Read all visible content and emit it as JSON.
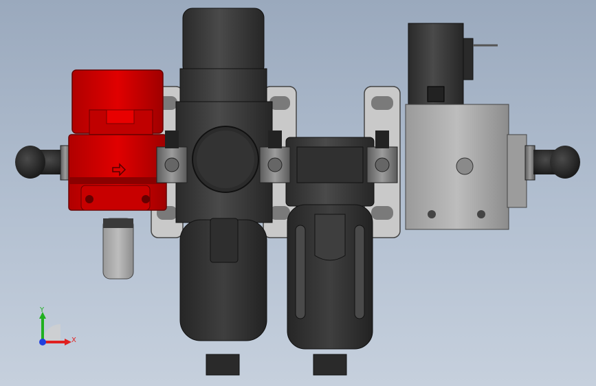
{
  "viewport": {
    "background_top": "#9aa9bd",
    "background_bottom": "#c6d0dd"
  },
  "model": {
    "accent_red": "#d90000",
    "body_dark": "#3a3a3a",
    "metal_gray": "#8a8a8a",
    "block_gray": "#a6a6a6"
  },
  "triad": {
    "x_label": "X",
    "y_label": "Y",
    "x_color": "#e02020",
    "y_color": "#20b020",
    "z_color": "#2040e0"
  }
}
